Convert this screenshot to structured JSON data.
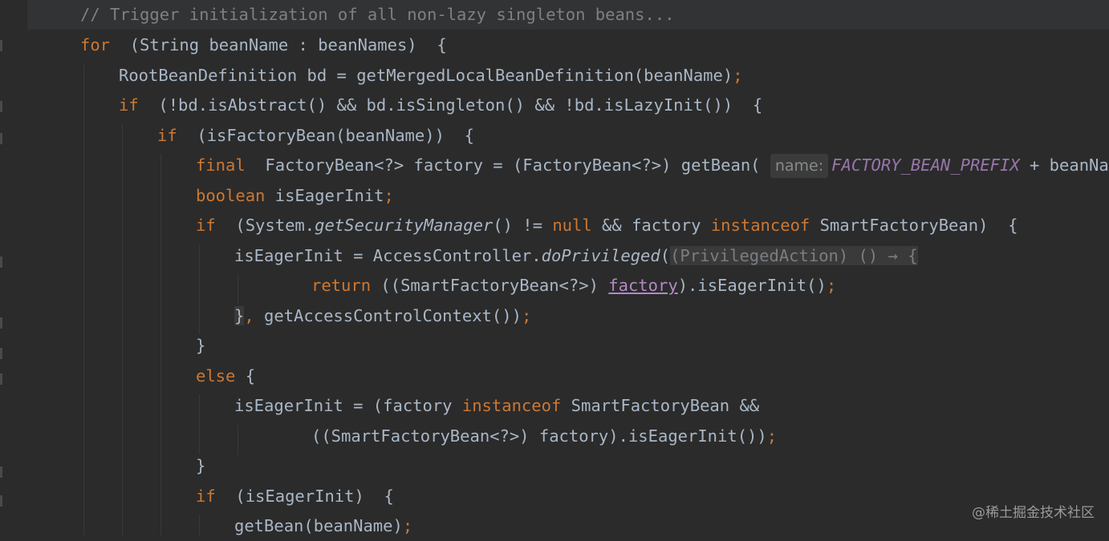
{
  "editor": {
    "lines": [
      {
        "id": "l0",
        "segments": [
          [
            "cmt",
            "// Trigger initialization of all non-lazy singleton beans..."
          ]
        ]
      },
      {
        "id": "l1",
        "segments": [
          [
            "kw",
            "for"
          ],
          [
            "",
            "  (String beanName : beanNames)  {"
          ]
        ]
      },
      {
        "id": "l2",
        "segments": [
          [
            "",
            "RootBeanDefinition bd = getMergedLocalBeanDefinition(beanName)"
          ],
          [
            "kw",
            ";"
          ]
        ]
      },
      {
        "id": "l3",
        "segments": [
          [
            "kw",
            "if"
          ],
          [
            "",
            "  (!bd.isAbstract() && bd.isSingleton() && !bd.isLazyInit())  {"
          ]
        ]
      },
      {
        "id": "l4",
        "segments": [
          [
            "kw",
            "if"
          ],
          [
            "",
            "  (isFactoryBean(beanName))  {"
          ]
        ]
      },
      {
        "id": "l5",
        "segments": [
          [
            "kw",
            "final"
          ],
          [
            "",
            "  FactoryBean<?> factory = (FactoryBean<?>) getBean( "
          ],
          [
            "hint",
            "name:"
          ],
          [
            "const",
            "FACTORY_BEAN_PREFIX"
          ],
          [
            "",
            " + beanName)"
          ]
        ]
      },
      {
        "id": "l6",
        "segments": [
          [
            "kw",
            "boolean"
          ],
          [
            "",
            " isEagerInit"
          ],
          [
            "kw",
            ";"
          ]
        ]
      },
      {
        "id": "l7",
        "segments": [
          [
            "kw",
            "if"
          ],
          [
            "",
            "  (System."
          ],
          [
            "ital",
            "getSecurityManager"
          ],
          [
            "",
            "() != "
          ],
          [
            "kw",
            "null"
          ],
          [
            "",
            " && factory "
          ],
          [
            "kw",
            "instanceof"
          ],
          [
            "",
            " SmartFactoryBean)  {"
          ]
        ]
      },
      {
        "id": "l8",
        "segments": [
          [
            "",
            "isEagerInit = AccessController."
          ],
          [
            "ital",
            "doPrivileged"
          ],
          [
            "",
            "("
          ],
          [
            "folded",
            "(PrivilegedAction) () → {"
          ]
        ]
      },
      {
        "id": "l9",
        "segments": [
          [
            "kw",
            "return"
          ],
          [
            "",
            " ((SmartFactoryBean<?>) "
          ],
          [
            "lam",
            "factory"
          ],
          [
            "",
            ").isEagerInit()"
          ],
          [
            "kw",
            ";"
          ]
        ]
      },
      {
        "id": "l10",
        "segments": [
          [
            "brace-hl",
            "}"
          ],
          [
            "kw",
            ","
          ],
          [
            "",
            " getAccessControlContext())"
          ],
          [
            "kw",
            ";"
          ]
        ]
      },
      {
        "id": "l11",
        "segments": [
          [
            "",
            "}"
          ]
        ]
      },
      {
        "id": "l12",
        "segments": [
          [
            "kw",
            "else"
          ],
          [
            "",
            " {"
          ]
        ]
      },
      {
        "id": "l13",
        "segments": [
          [
            "",
            "isEagerInit = (factory "
          ],
          [
            "kw",
            "instanceof"
          ],
          [
            "",
            " SmartFactoryBean &&"
          ]
        ]
      },
      {
        "id": "l14",
        "segments": [
          [
            "",
            "((SmartFactoryBean<?>) factory).isEagerInit())"
          ],
          [
            "kw",
            ";"
          ]
        ]
      },
      {
        "id": "l15",
        "segments": [
          [
            "",
            "}"
          ]
        ]
      },
      {
        "id": "l16",
        "segments": [
          [
            "kw",
            "if"
          ],
          [
            "",
            "  (isEagerInit)  {"
          ]
        ]
      },
      {
        "id": "l17",
        "segments": [
          [
            "",
            "getBean(beanName)"
          ],
          [
            "kw",
            ";"
          ]
        ]
      }
    ]
  },
  "watermark": "@稀土掘金技术社区",
  "colors": {
    "background": "#2b2b2b",
    "keyword": "#cc7832",
    "comment": "#808080",
    "text": "#a9b7c6",
    "constant": "#9876aa"
  }
}
